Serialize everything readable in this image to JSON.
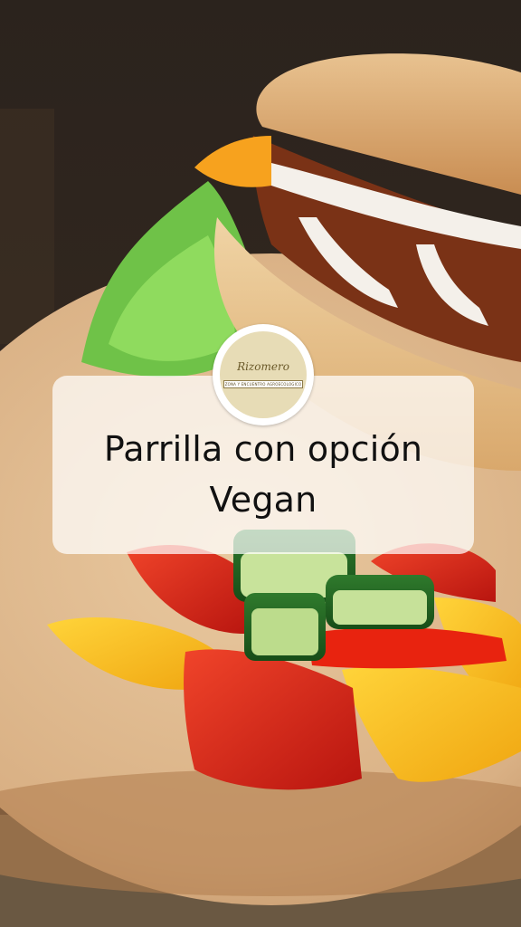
{
  "caption": {
    "line1": "Parrilla con opción",
    "line2": "Vegan"
  },
  "logo": {
    "name": "Rizomero",
    "tagline": "ZONA Y ENCUENTRO AGROECOLOGICO"
  },
  "colors": {
    "card": "#ffffff",
    "text": "#111111",
    "logo_bg": "#e7dcb6"
  }
}
